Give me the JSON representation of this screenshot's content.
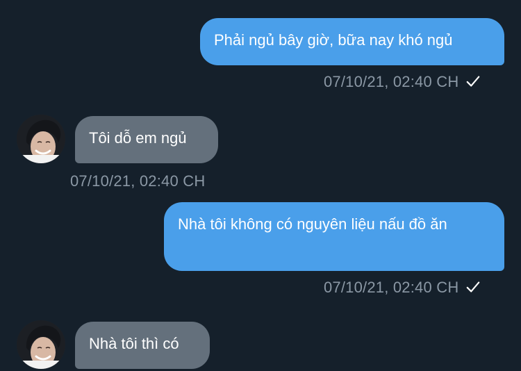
{
  "colors": {
    "background": "#15202b",
    "outgoing_bubble": "#4a9fea",
    "incoming_bubble": "#64707c",
    "timestamp": "#8b98a5"
  },
  "messages": [
    {
      "direction": "outgoing",
      "text": "Phải ngủ bây giờ, bữa nay khó ngủ",
      "timestamp": "07/10/21, 02:40 CH",
      "status_icon": "checkmark-icon"
    },
    {
      "direction": "incoming",
      "avatar_icon": "avatar",
      "text": "Tôi dỗ em ngủ",
      "timestamp": "07/10/21, 02:40 CH"
    },
    {
      "direction": "outgoing",
      "text": "Nhà tôi không có nguyên liệu nấu đồ ăn",
      "timestamp": "07/10/21, 02:40 CH",
      "status_icon": "checkmark-icon"
    },
    {
      "direction": "incoming",
      "avatar_icon": "avatar",
      "text": "Nhà tôi thì có"
    }
  ]
}
